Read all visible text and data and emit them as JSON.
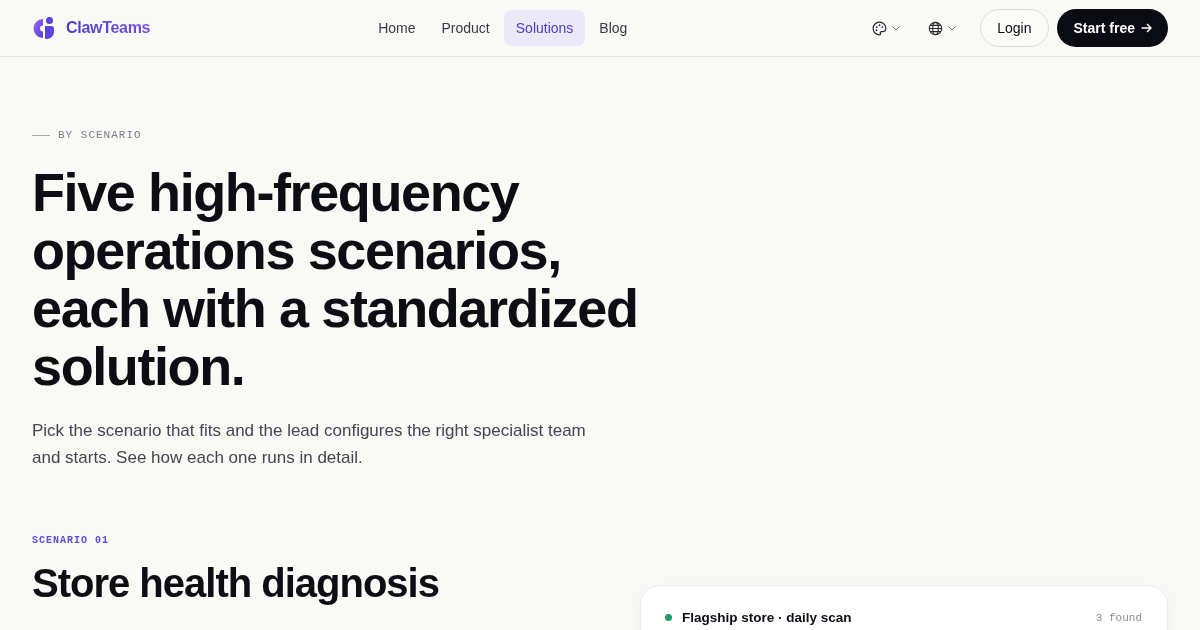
{
  "header": {
    "brand": "ClawTeams",
    "nav": [
      {
        "label": "Home",
        "selected": false
      },
      {
        "label": "Product",
        "selected": false
      },
      {
        "label": "Solutions",
        "selected": true
      },
      {
        "label": "Blog",
        "selected": false
      }
    ],
    "login": "Login",
    "cta": "Start free"
  },
  "hero": {
    "eyebrow": "BY SCENARIO",
    "title": "Five high-frequency operations scenarios, each with a standardized solution.",
    "subtitle": "Pick the scenario that fits and the lead configures the right specialist team and starts. See how each one runs in detail."
  },
  "scenario": {
    "label": "SCENARIO 01",
    "title": "Store health diagnosis",
    "card": {
      "rows": [
        {
          "title": "Flagship store · daily scan",
          "count": "3 found",
          "color": "#1f9d62"
        }
      ]
    }
  }
}
